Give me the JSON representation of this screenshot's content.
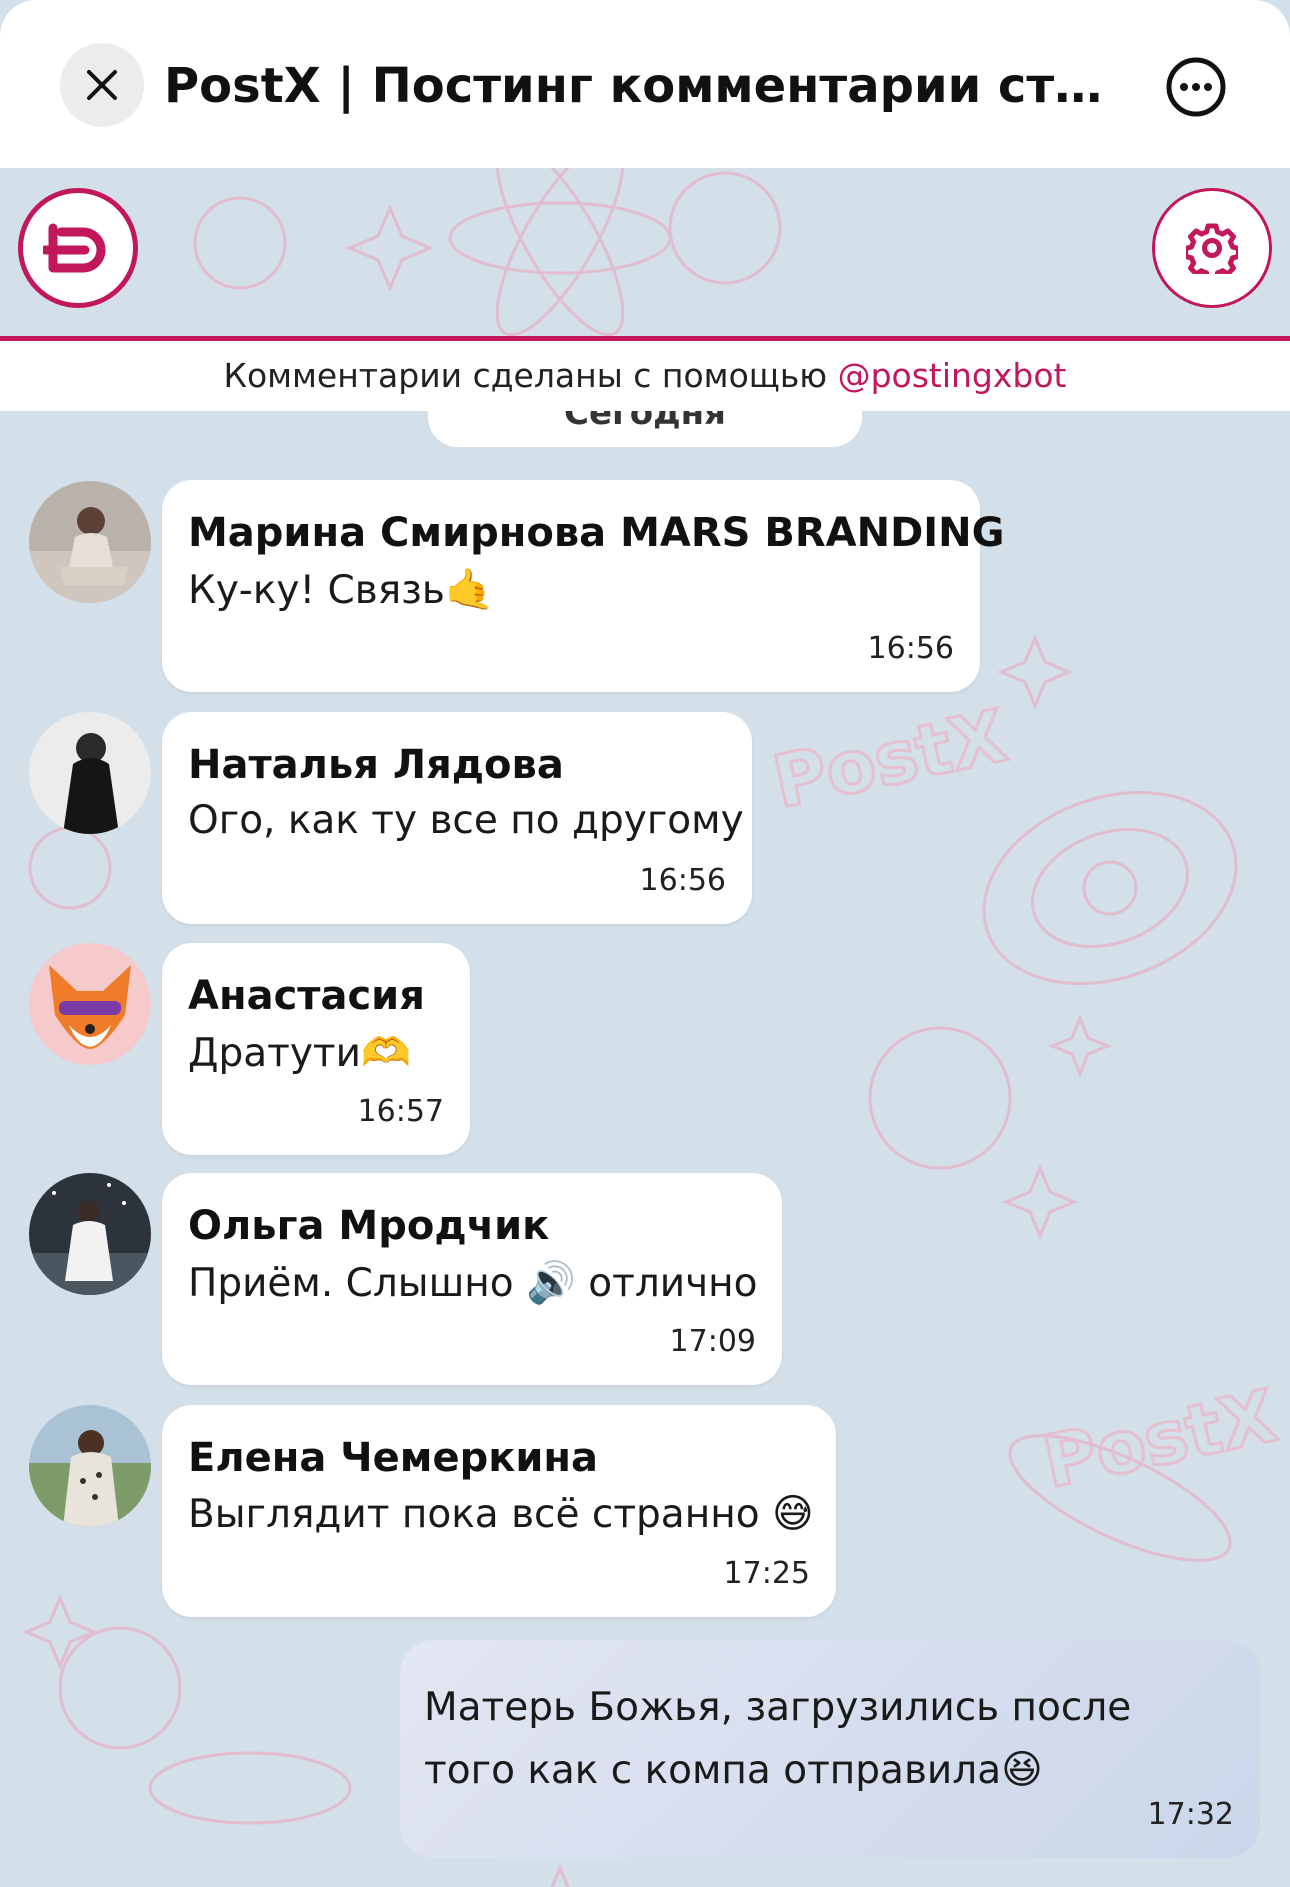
{
  "window": {
    "title": "PostX | Постинг комментарии стати..."
  },
  "banner": {
    "credit_text": "Комментарии сделаны с помощью ",
    "credit_link": "@postingxbot",
    "date_label": "Сегодня",
    "accent_color": "#c2185b"
  },
  "messages": [
    {
      "sender": "Марина Смирнова MARS BRANDING",
      "text": "Ку-ку! Связь",
      "emoji": "🤙",
      "time": "16:56",
      "avatar": "photo"
    },
    {
      "sender": "Наталья Лядова",
      "text": "Ого, как ту все по другому",
      "emoji": "",
      "time": "16:56",
      "avatar": "photo"
    },
    {
      "sender": "Анастасия",
      "text": "Дратути",
      "emoji": "🫶",
      "time": "16:57",
      "avatar": "fox"
    },
    {
      "sender": "Ольга Мродчик",
      "text": "Приём. Слышно",
      "emoji": "🔊",
      "text_after": "отлично",
      "time": "17:09",
      "avatar": "photo"
    },
    {
      "sender": "Елена Чемеркина",
      "text": "Выглядит пока всё странно",
      "emoji": "😅",
      "time": "17:25",
      "avatar": "photo"
    }
  ],
  "own_message": {
    "text": "Матерь Божья, загрузились после того как с компа отправила",
    "emoji": "😆",
    "time": "17:32"
  },
  "icons": {
    "close": "close-icon",
    "more": "more-icon",
    "logo": "postx-logo-icon",
    "settings": "gear-icon"
  }
}
